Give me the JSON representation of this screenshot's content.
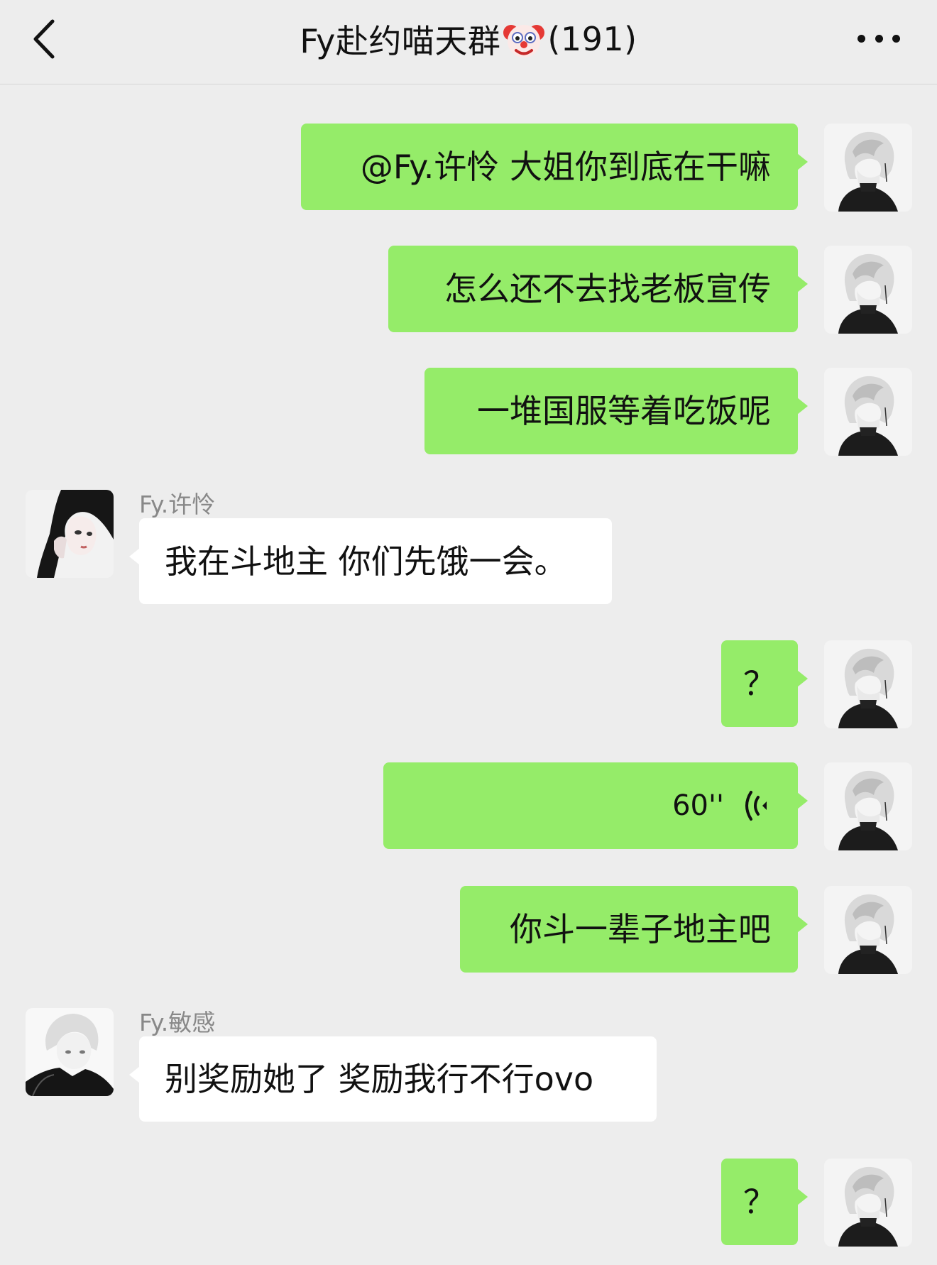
{
  "header": {
    "title_prefix": "Fy赴约喵天群",
    "title_icon": "clown-emoji",
    "member_count": "(191)",
    "back_icon": "chevron-left-icon",
    "more_icon": "more-dots-icon"
  },
  "messages": [
    {
      "direction": "out",
      "text": "@Fy.许怜 大姐你到底在干嘛",
      "avatar": "white-hair-avatar"
    },
    {
      "direction": "out",
      "text": "怎么还不去找老板宣传",
      "avatar": "white-hair-avatar"
    },
    {
      "direction": "out",
      "text": "一堆国服等着吃饭呢",
      "avatar": "white-hair-avatar"
    },
    {
      "direction": "in",
      "sender": "Fy.许怜",
      "text": "我在斗地主 你们先饿一会。",
      "avatar": "girl-avatar"
    },
    {
      "direction": "out",
      "text": "？",
      "avatar": "white-hair-avatar"
    },
    {
      "direction": "out",
      "type": "voice",
      "duration": "60''",
      "avatar": "white-hair-avatar"
    },
    {
      "direction": "out",
      "text": "你斗一辈子地主吧",
      "avatar": "white-hair-avatar"
    },
    {
      "direction": "in",
      "sender": "Fy.敏感",
      "text": "别奖励她了 奖励我行不行ovo",
      "avatar": "white-hair-boy-avatar"
    },
    {
      "direction": "out",
      "text": "？",
      "avatar": "white-hair-avatar"
    }
  ],
  "colors": {
    "background": "#ededed",
    "outgoing_bubble": "#95ec69",
    "incoming_bubble": "#ffffff",
    "sender_name": "#888888"
  }
}
